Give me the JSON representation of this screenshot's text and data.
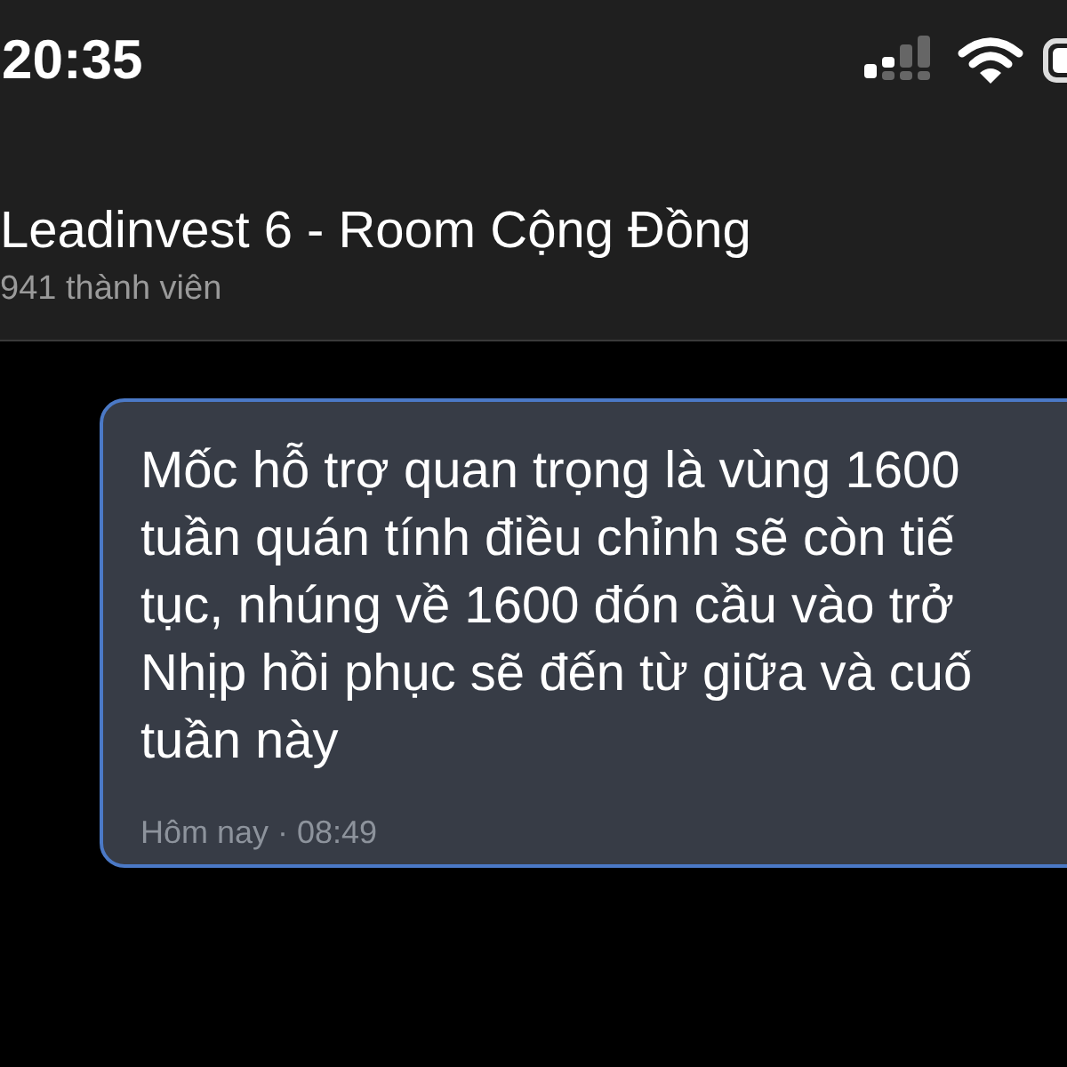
{
  "status_bar": {
    "time": "20:35"
  },
  "header": {
    "title": "Leadinvest 6 - Room Cộng Đồng",
    "subtitle": "941 thành viên"
  },
  "message": {
    "lines": [
      "Mốc hỗ trợ quan trọng là vùng 1600",
      "tuần quán tính điều chỉnh sẽ còn tiế",
      "tục, nhúng về 1600 đón cầu vào trở",
      "Nhịp hồi phục sẽ đến từ giữa và cuố",
      "tuần này"
    ],
    "timestamp": "Hôm nay · 08:49"
  }
}
